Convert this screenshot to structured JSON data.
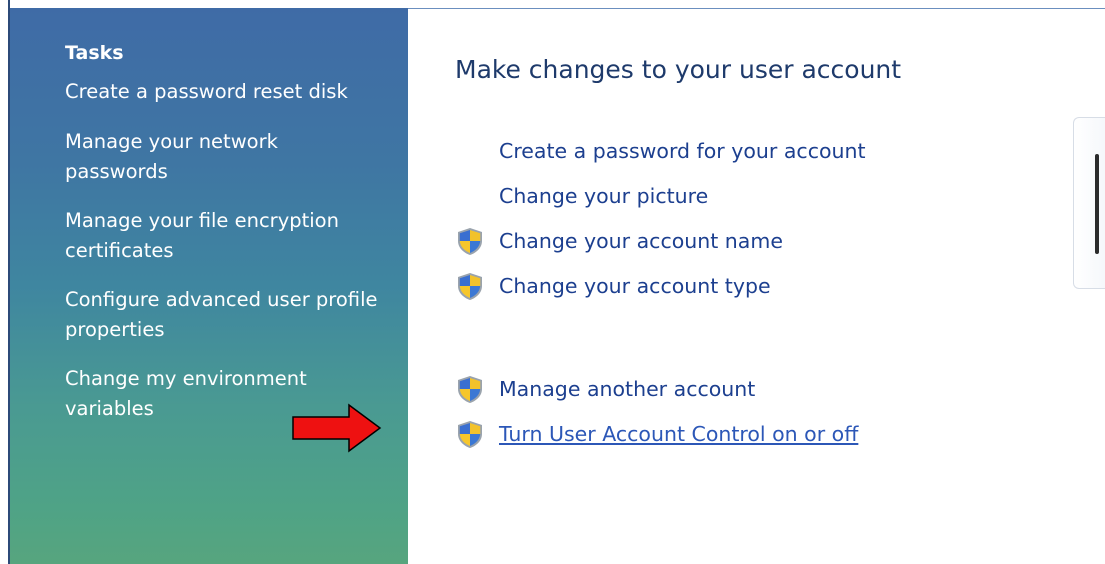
{
  "sidebar": {
    "heading": "Tasks",
    "items": [
      {
        "label": "Create a password reset disk"
      },
      {
        "label": "Manage your network passwords"
      },
      {
        "label": "Manage your file encryption certificates"
      },
      {
        "label": "Configure advanced user profile properties"
      },
      {
        "label": "Change my environment variables"
      }
    ]
  },
  "main": {
    "title": "Make changes to your user account",
    "links": [
      {
        "label": "Create a password for your account",
        "icon": "none"
      },
      {
        "label": "Change your picture",
        "icon": "none"
      },
      {
        "label": "Change your account name",
        "icon": "uac-shield-icon"
      },
      {
        "label": "Change your account type",
        "icon": "uac-shield-icon"
      },
      {
        "label": "Manage another account",
        "icon": "uac-shield-icon"
      },
      {
        "label": "Turn User Account Control on or off",
        "icon": "uac-shield-icon"
      }
    ]
  },
  "annotation": {
    "icon": "red-arrow-icon",
    "color": "#ee1111"
  },
  "colors": {
    "sidebar_top": "#3f6ba6",
    "sidebar_bottom": "#57a57e",
    "link": "#1c3f8f",
    "title": "#1e3a6b"
  }
}
